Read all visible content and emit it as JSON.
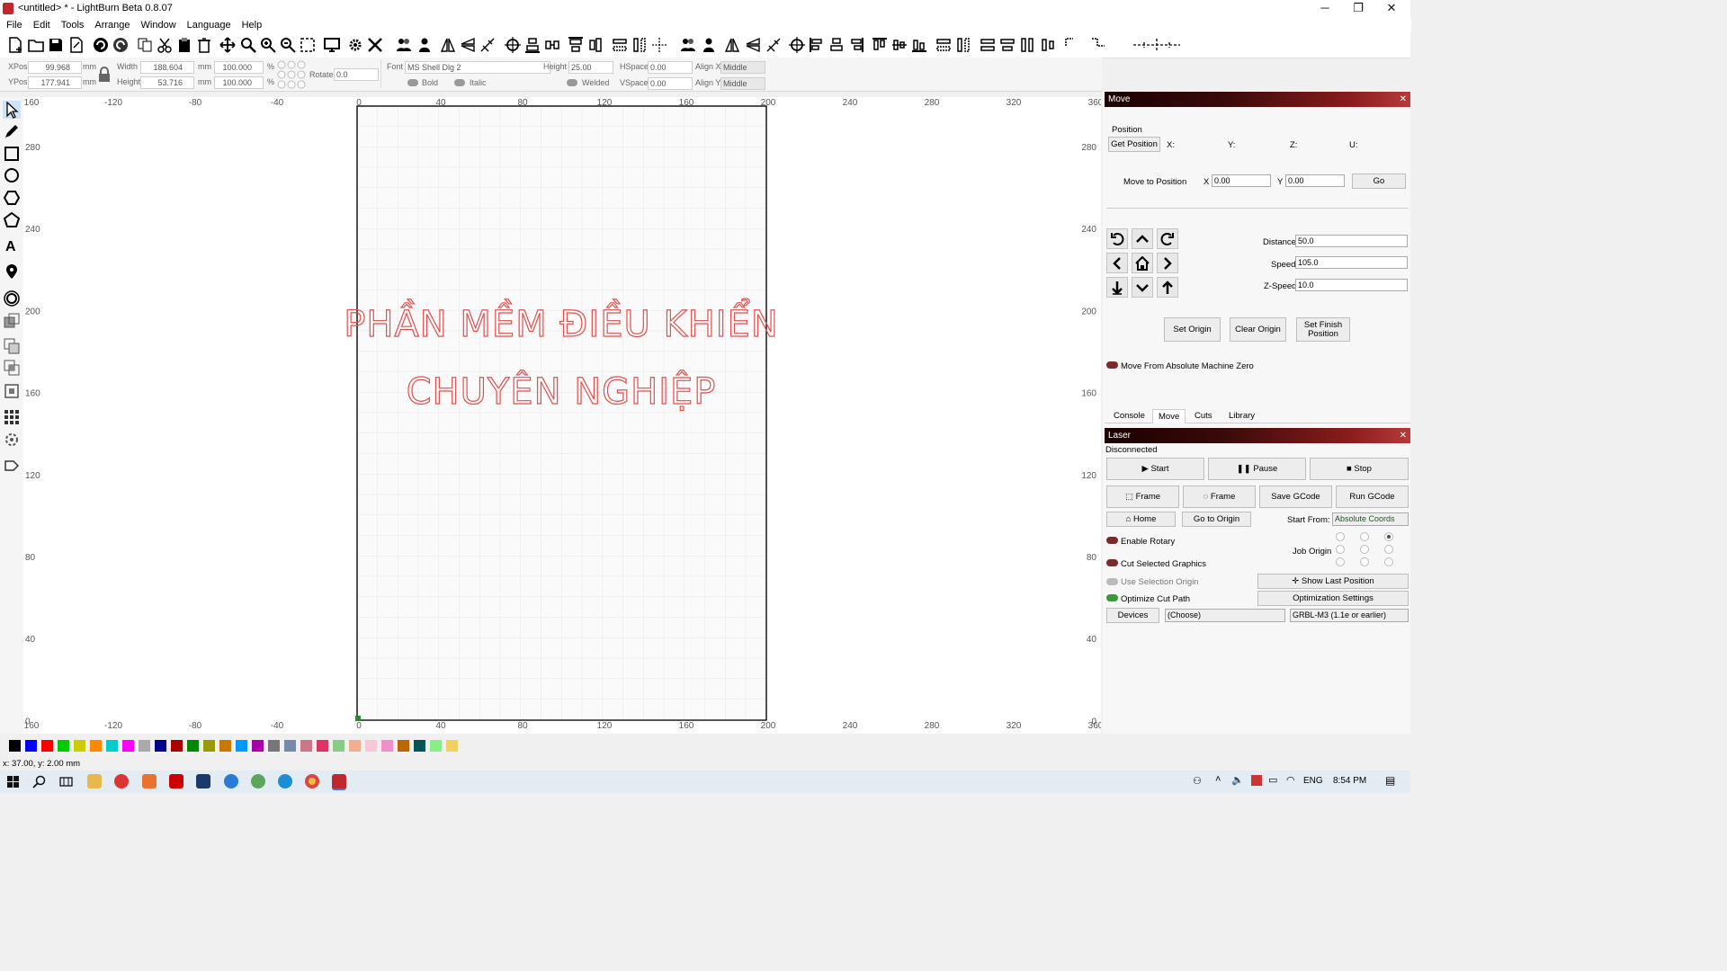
{
  "window": {
    "title": "<untitled> * - LightBurn Beta 0.8.07",
    "min": "─",
    "max": "❐",
    "close": "✕"
  },
  "menu": [
    "File",
    "Edit",
    "Tools",
    "Arrange",
    "Window",
    "Language",
    "Help"
  ],
  "props": {
    "xpos_label": "XPos",
    "xpos": "99.968",
    "ypos_label": "YPos",
    "ypos": "177.941",
    "unit": "mm",
    "width_label": "Width",
    "width": "188.604",
    "height_label": "Height",
    "height": "53.716",
    "scale_w": "100.000",
    "scale_h": "100.000",
    "pct": "%",
    "rotate_label": "Rotate",
    "rotate": "0.0",
    "font_label": "Font",
    "font": "MS Shell Dlg 2",
    "fheight_label": "Height",
    "fheight": "25.00",
    "hspace_label": "HSpace",
    "hspace": "0.00",
    "vspace_label": "VSpace",
    "vspace": "0.00",
    "alignx_label": "Align X",
    "alignx": "Middle",
    "aligny_label": "Align Y",
    "aligny": "Middle",
    "bold": "Bold",
    "italic": "Italic",
    "welded": "Welded"
  },
  "canvas": {
    "line1": "PHẦN MỀM ĐIỀU KHIỂN",
    "line2": "CHUYÊN NGHIỆP",
    "text_color": "#e05050",
    "x_ticks_top": [
      "160",
      "-120",
      "-80",
      "-40",
      "0",
      "40",
      "80",
      "120",
      "160",
      "200",
      "240",
      "280",
      "320",
      "360"
    ],
    "x_ticks_bottom": [
      "160",
      "-120",
      "-80",
      "-40",
      "0",
      "40",
      "80",
      "120",
      "160",
      "200",
      "240",
      "280",
      "320",
      "360"
    ],
    "y_ticks": [
      "280",
      "240",
      "200",
      "160",
      "120",
      "80",
      "40",
      "0"
    ]
  },
  "move": {
    "title": "Move",
    "position_label": "Position",
    "get_position": "Get Position",
    "x_label": "X:",
    "y_label": "Y:",
    "z_label": "Z:",
    "u_label": "U:",
    "move_to_label": "Move to Position",
    "mx_label": "X",
    "mx": "0.00",
    "my_label": "Y",
    "my": "0.00",
    "go": "Go",
    "distance_label": "Distance",
    "distance": "50.0",
    "speed_label": "Speed",
    "speed": "105.0",
    "zspeed_label": "Z-Speed",
    "zspeed": "10.0",
    "set_origin": "Set Origin",
    "clear_origin": "Clear Origin",
    "set_finish": "Set Finish Position",
    "abs_zero": "Move From Absolute Machine Zero"
  },
  "tabs": [
    "Console",
    "Move",
    "Cuts",
    "Library"
  ],
  "laser": {
    "title": "Laser",
    "status": "Disconnected",
    "start": "Start",
    "pause": "Pause",
    "stop": "Stop",
    "frame1": "Frame",
    "frame2": "Frame",
    "save_gcode": "Save GCode",
    "run_gcode": "Run GCode",
    "home": "Home",
    "go_origin": "Go to Origin",
    "start_from_label": "Start From:",
    "start_from": "Absolute Coords",
    "enable_rotary": "Enable Rotary",
    "job_origin": "Job Origin",
    "cut_selected": "Cut Selected Graphics",
    "use_sel_origin": "Use Selection Origin",
    "show_last": "Show Last Position",
    "optimize": "Optimize Cut Path",
    "opt_settings": "Optimization Settings",
    "devices": "Devices",
    "device_choice": "(Choose)",
    "device_type": "GRBL-M3 (1.1e or earlier)"
  },
  "palette": [
    "#000000",
    "#0000ff",
    "#ff0000",
    "#00cc00",
    "#cccc00",
    "#ff8800",
    "#00cccc",
    "#ff00ff",
    "#aaaaaa",
    "#000088",
    "#aa0000",
    "#008800",
    "#999900",
    "#cc7700",
    "#0099ff",
    "#aa00aa",
    "#777777",
    "#7788aa",
    "#cc7788",
    "#dd3366",
    "#88cc88",
    "#f0b090",
    "#f8c8d8",
    "#f090c8",
    "#bb6600",
    "#005555",
    "#88ee88",
    "#f0d060"
  ],
  "status": {
    "coords": "x: 37.00, y: 2.00 mm"
  },
  "taskbar": {
    "time": "8:54 PM",
    "lang": "ENG"
  }
}
